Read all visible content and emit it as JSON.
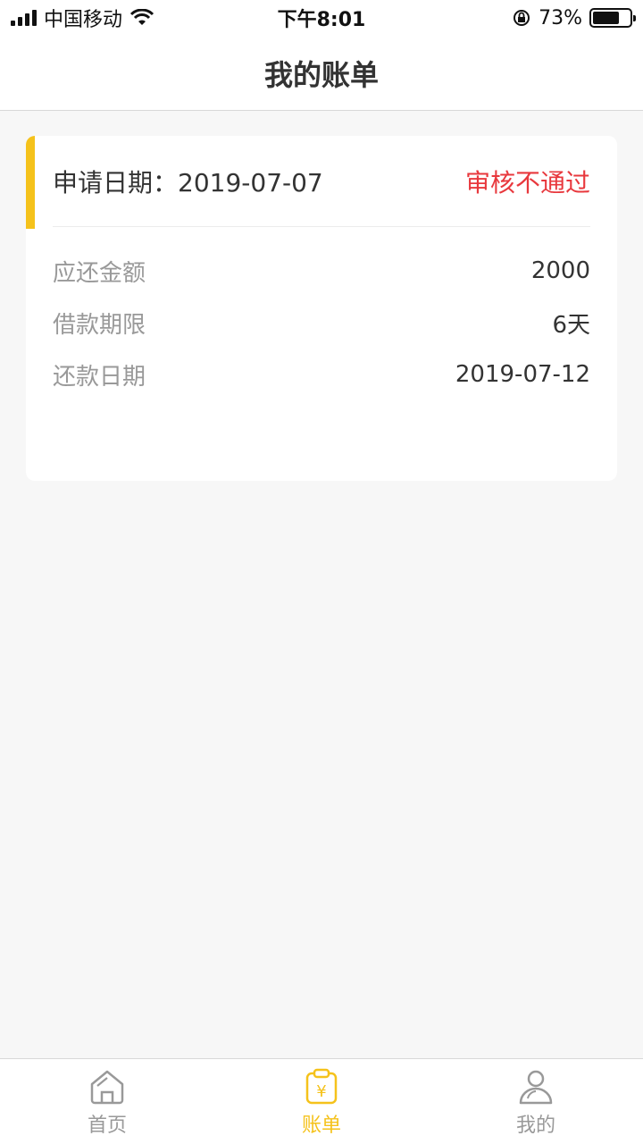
{
  "status_bar": {
    "carrier": "中国移动",
    "time": "下午8:01",
    "battery": "73%",
    "battery_level": 0.73,
    "icons": [
      "signal-icon",
      "wifi-icon",
      "orientation-lock-icon",
      "battery-icon"
    ]
  },
  "header": {
    "title": "我的账单"
  },
  "bill": {
    "date_label": "申请日期：",
    "date_value": "2019-07-07",
    "status": "审核不通过",
    "status_color": "#e8383d",
    "accent_color": "#f5c21b",
    "rows": [
      {
        "label": "应还金额",
        "value": "2000"
      },
      {
        "label": "借款期限",
        "value": "6天"
      },
      {
        "label": "还款日期",
        "value": "2019-07-12"
      }
    ]
  },
  "tabbar": {
    "items": [
      {
        "label": "首页",
        "icon": "home-icon",
        "active": false
      },
      {
        "label": "账单",
        "icon": "bill-icon",
        "active": true
      },
      {
        "label": "我的",
        "icon": "profile-icon",
        "active": false
      }
    ],
    "active_color": "#f5c21b",
    "inactive_color": "#999999"
  }
}
